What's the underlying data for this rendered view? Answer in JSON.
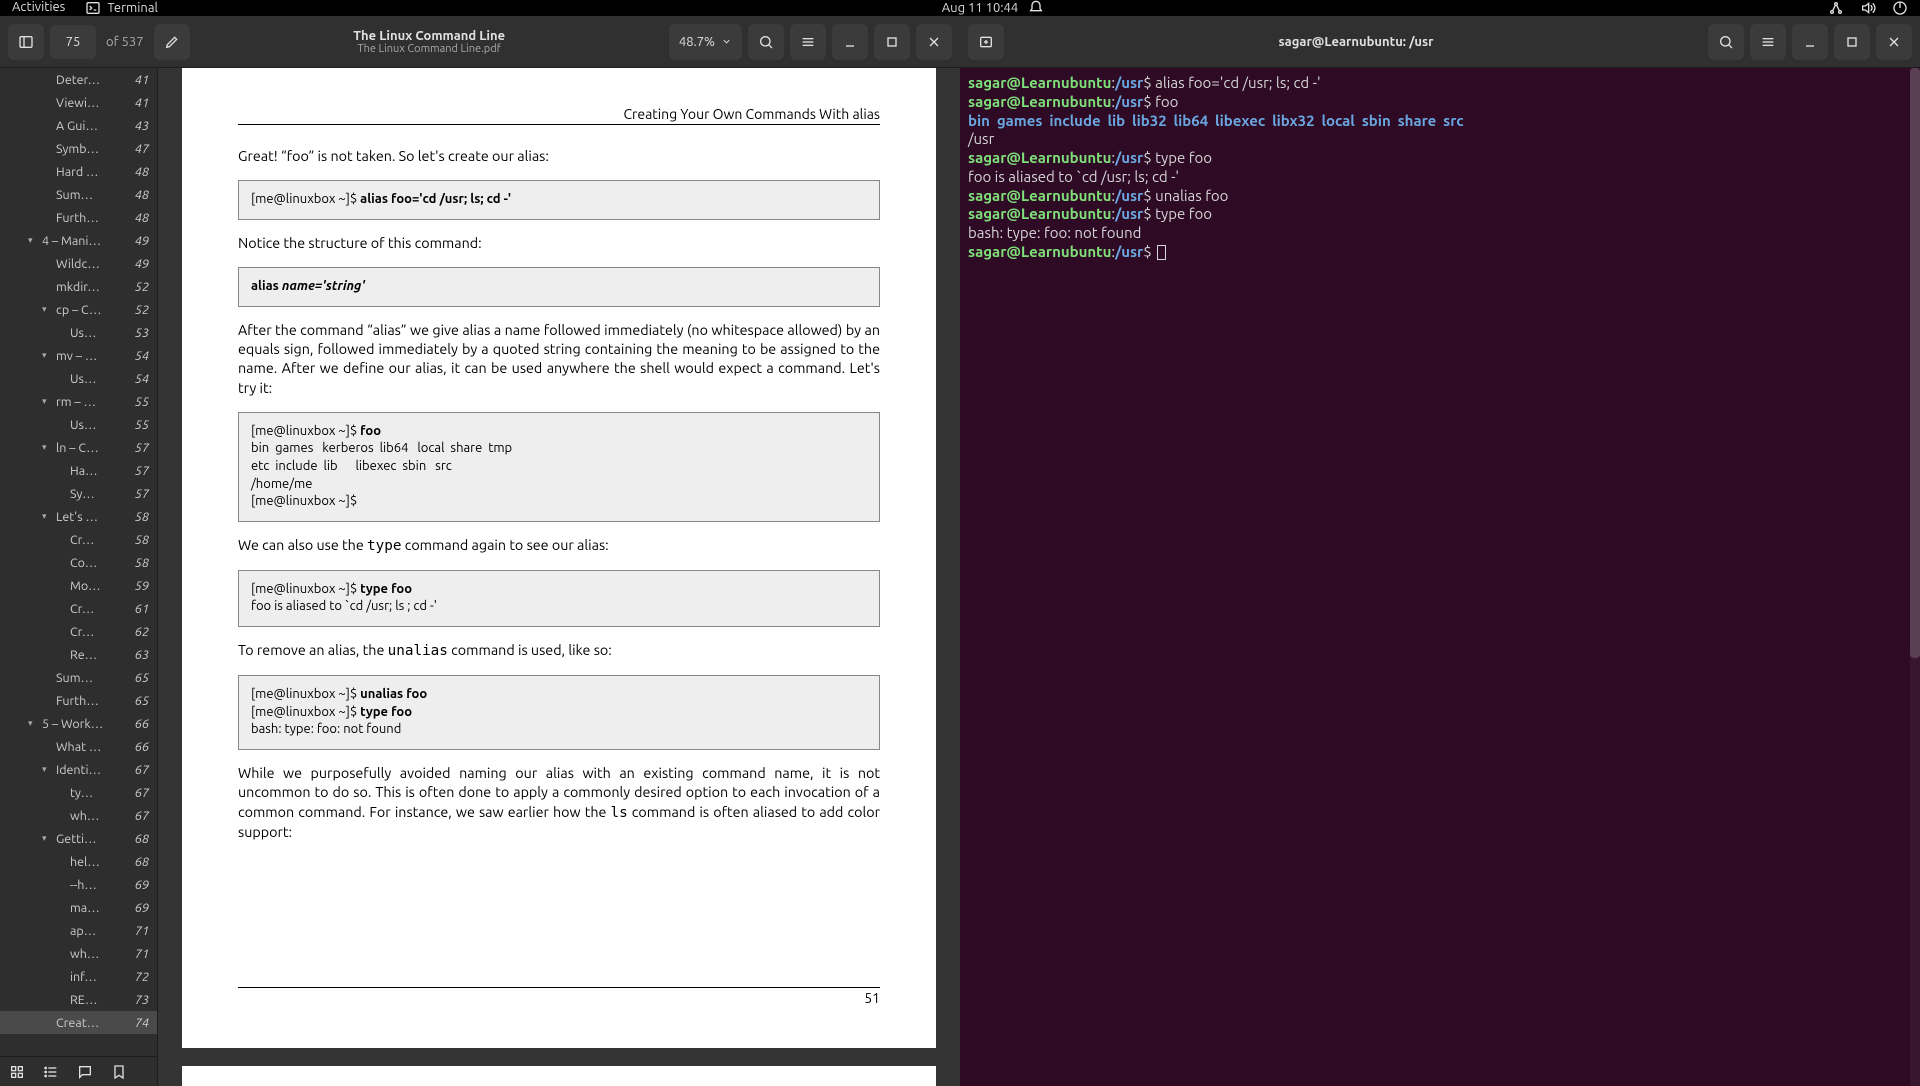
{
  "topbar": {
    "activities": "Activities",
    "app": "Terminal",
    "datetime": "Aug 11  10:44"
  },
  "evince": {
    "page_current": "75",
    "page_of": "of 537",
    "title": "The Linux Command Line",
    "subtitle": "The Linux Command Line.pdf",
    "zoom": "48.7%"
  },
  "outline": [
    {
      "d": 3,
      "exp": "",
      "l": "Deter…",
      "p": "41"
    },
    {
      "d": 3,
      "exp": "",
      "l": "Viewi…",
      "p": "41"
    },
    {
      "d": 3,
      "exp": "",
      "l": "A Gui…",
      "p": "43"
    },
    {
      "d": 3,
      "exp": "",
      "l": "Symb…",
      "p": "47"
    },
    {
      "d": 3,
      "exp": "",
      "l": "Hard …",
      "p": "48"
    },
    {
      "d": 3,
      "exp": "",
      "l": "Sum…",
      "p": "48"
    },
    {
      "d": 3,
      "exp": "",
      "l": "Furth…",
      "p": "48"
    },
    {
      "d": 2,
      "exp": "▾",
      "l": "4 – Mani…",
      "p": "49"
    },
    {
      "d": 3,
      "exp": "",
      "l": "Wildc…",
      "p": "49"
    },
    {
      "d": 3,
      "exp": "",
      "l": "mkdir…",
      "p": "52"
    },
    {
      "d": 3,
      "exp": "▾",
      "l": "cp – C…",
      "p": "52"
    },
    {
      "d": 4,
      "exp": "",
      "l": "Us…",
      "p": "53"
    },
    {
      "d": 3,
      "exp": "▾",
      "l": "mv – …",
      "p": "54"
    },
    {
      "d": 4,
      "exp": "",
      "l": "Us…",
      "p": "54"
    },
    {
      "d": 3,
      "exp": "▾",
      "l": "rm – …",
      "p": "55"
    },
    {
      "d": 4,
      "exp": "",
      "l": "Us…",
      "p": "55"
    },
    {
      "d": 3,
      "exp": "▾",
      "l": "ln – C…",
      "p": "57"
    },
    {
      "d": 4,
      "exp": "",
      "l": "Ha…",
      "p": "57"
    },
    {
      "d": 4,
      "exp": "",
      "l": "Sy…",
      "p": "57"
    },
    {
      "d": 3,
      "exp": "▾",
      "l": "Let's …",
      "p": "58"
    },
    {
      "d": 4,
      "exp": "",
      "l": "Cr…",
      "p": "58"
    },
    {
      "d": 4,
      "exp": "",
      "l": "Co…",
      "p": "58"
    },
    {
      "d": 4,
      "exp": "",
      "l": "Mo…",
      "p": "59"
    },
    {
      "d": 4,
      "exp": "",
      "l": "Cr…",
      "p": "61"
    },
    {
      "d": 4,
      "exp": "",
      "l": "Cr…",
      "p": "62"
    },
    {
      "d": 4,
      "exp": "",
      "l": "Re…",
      "p": "63"
    },
    {
      "d": 3,
      "exp": "",
      "l": "Sum…",
      "p": "65"
    },
    {
      "d": 3,
      "exp": "",
      "l": "Furth…",
      "p": "65"
    },
    {
      "d": 2,
      "exp": "▾",
      "l": "5 – Work…",
      "p": "66"
    },
    {
      "d": 3,
      "exp": "",
      "l": "What …",
      "p": "66"
    },
    {
      "d": 3,
      "exp": "▾",
      "l": "Identi…",
      "p": "67"
    },
    {
      "d": 4,
      "exp": "",
      "l": "ty…",
      "p": "67"
    },
    {
      "d": 4,
      "exp": "",
      "l": "wh…",
      "p": "67"
    },
    {
      "d": 3,
      "exp": "▾",
      "l": "Getti…",
      "p": "68"
    },
    {
      "d": 4,
      "exp": "",
      "l": "hel…",
      "p": "68"
    },
    {
      "d": 4,
      "exp": "",
      "l": "--h…",
      "p": "69"
    },
    {
      "d": 4,
      "exp": "",
      "l": "ma…",
      "p": "69"
    },
    {
      "d": 4,
      "exp": "",
      "l": "ap…",
      "p": "71"
    },
    {
      "d": 4,
      "exp": "",
      "l": "wh…",
      "p": "71"
    },
    {
      "d": 4,
      "exp": "",
      "l": "inf…",
      "p": "72"
    },
    {
      "d": 4,
      "exp": "",
      "l": "RE…",
      "p": "73"
    },
    {
      "d": 3,
      "exp": "",
      "l": "Creat…",
      "p": "74",
      "sel": true
    }
  ],
  "page": {
    "header": "Creating Your Own Commands With alias",
    "p1": "Great! “foo” is not taken. So let's create our alias:",
    "code1_prompt": "[me@linuxbox ~]$ ",
    "code1_bold": "alias foo='cd /usr; ls; cd -'",
    "p2": "Notice the structure of this command:",
    "code2_pre": "alias ",
    "code2_ital": "name='string'",
    "p3": "After the command “alias” we give alias a name followed immediately (no whitespace allowed) by an equals sign, followed immediately by a quoted string containing the meaning to be assigned to the name. After we define our alias, it can be used anywhere the shell would expect a command. Let's try it:",
    "code3_l1": "[me@linuxbox ~]$ ",
    "code3_l1b": "foo",
    "code3_l2": "bin  games   kerberos  lib64   local  share  tmp",
    "code3_l3": "etc  include  lib      libexec  sbin   src",
    "code3_l4": "/home/me",
    "code3_l5": "[me@linuxbox ~]$",
    "p4_a": "We can also use the ",
    "p4_m": "type",
    "p4_b": " command again to see our alias:",
    "code4_l1": "[me@linuxbox ~]$ ",
    "code4_l1b": "type foo",
    "code4_l2": "foo is aliased to `cd /usr; ls ; cd -'",
    "p5_a": "To remove an alias, the ",
    "p5_m": "unalias",
    "p5_b": " command is used, like so:",
    "code5_l1": "[me@linuxbox ~]$ ",
    "code5_l1b": "unalias foo",
    "code5_l2": "[me@linuxbox ~]$ ",
    "code5_l2b": "type foo",
    "code5_l3": "bash: type: foo: not found",
    "p6_a": "While we purposefully avoided naming our alias with an existing command name, it is not uncommon to do so. This is often done to apply a commonly desired option to each invocation of a common command. For instance, we saw earlier how the ",
    "p6_m": "ls",
    "p6_b": " command is often aliased to add color support:",
    "pageno": "51"
  },
  "terminal": {
    "title": "sagar@Learnubuntu: /usr",
    "user": "sagar@Learnubuntu",
    "path": "/usr",
    "cmd1": "alias foo='cd /usr; ls; cd -'",
    "cmd2": "foo",
    "dirs": [
      "bin",
      "games",
      "include",
      "lib",
      "lib32",
      "lib64",
      "libexec",
      "libx32",
      "local",
      "sbin",
      "share",
      "src"
    ],
    "out1": "/usr",
    "cmd3": "type foo",
    "out2": "foo is aliased to `cd /usr; ls; cd -'",
    "cmd4": "unalias foo",
    "cmd5": "type foo",
    "out3": "bash: type: foo: not found"
  }
}
